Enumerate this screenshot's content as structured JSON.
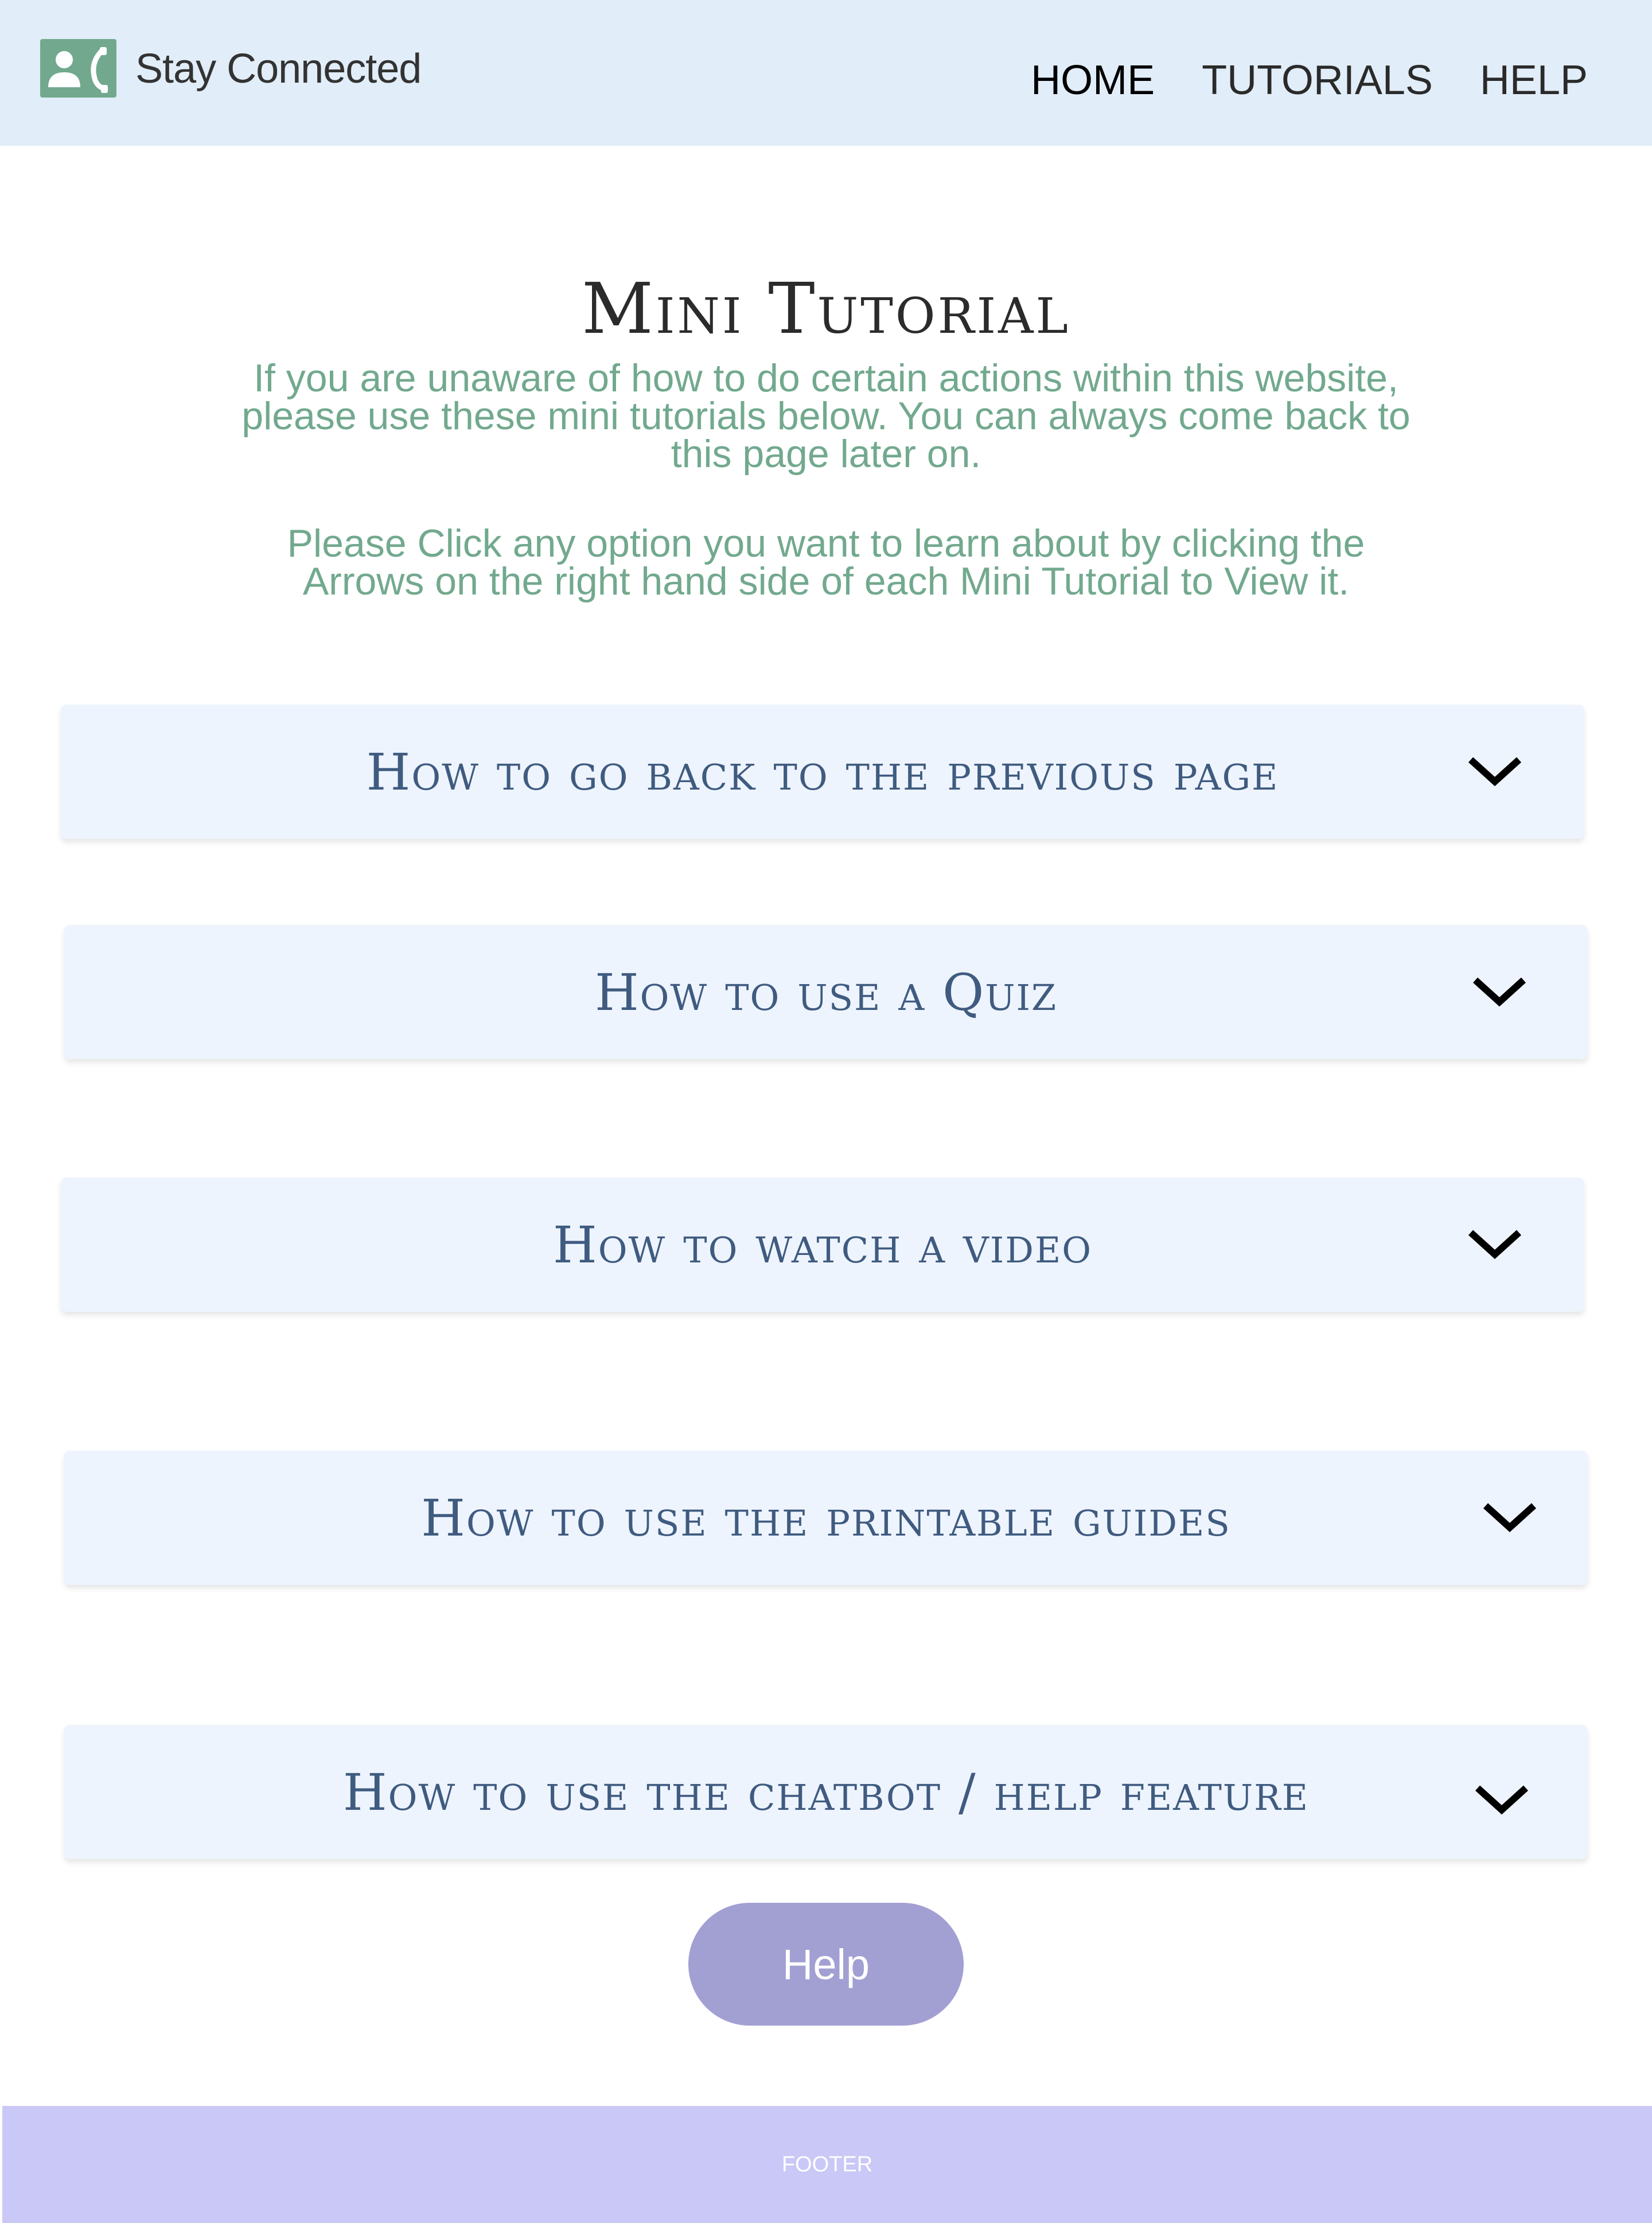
{
  "header": {
    "brand": "Stay Connected",
    "logo_icon": "contact-phone-icon",
    "nav": [
      "HOME",
      "TUTORIALS",
      "HELP"
    ]
  },
  "main": {
    "title": "Mini Tutorial",
    "intro": [
      "If you are unaware of how to do certain actions within this website, please use these mini tutorials below. You can always come back to this page later on.",
      "Please Click any option you want to learn about by clicking the Arrows on the right hand side of each Mini Tutorial to View it."
    ],
    "tutorials": [
      "How to go back to the previous page",
      "How to use a Quiz",
      "How to watch a video",
      "How to use the printable guides",
      "How to use the chatbot / help feature"
    ],
    "tutorial_icon": "chevron-down-icon"
  },
  "help_button": "Help",
  "footer": "FOOTER",
  "colors": {
    "header_bg": "#e1edf8",
    "accent_green": "#72a98e",
    "accordion_bg": "#eef4fd",
    "accordion_text": "#3f5b80",
    "help_button_bg": "#a29fd3",
    "footer_bg": "#cac8f7"
  }
}
